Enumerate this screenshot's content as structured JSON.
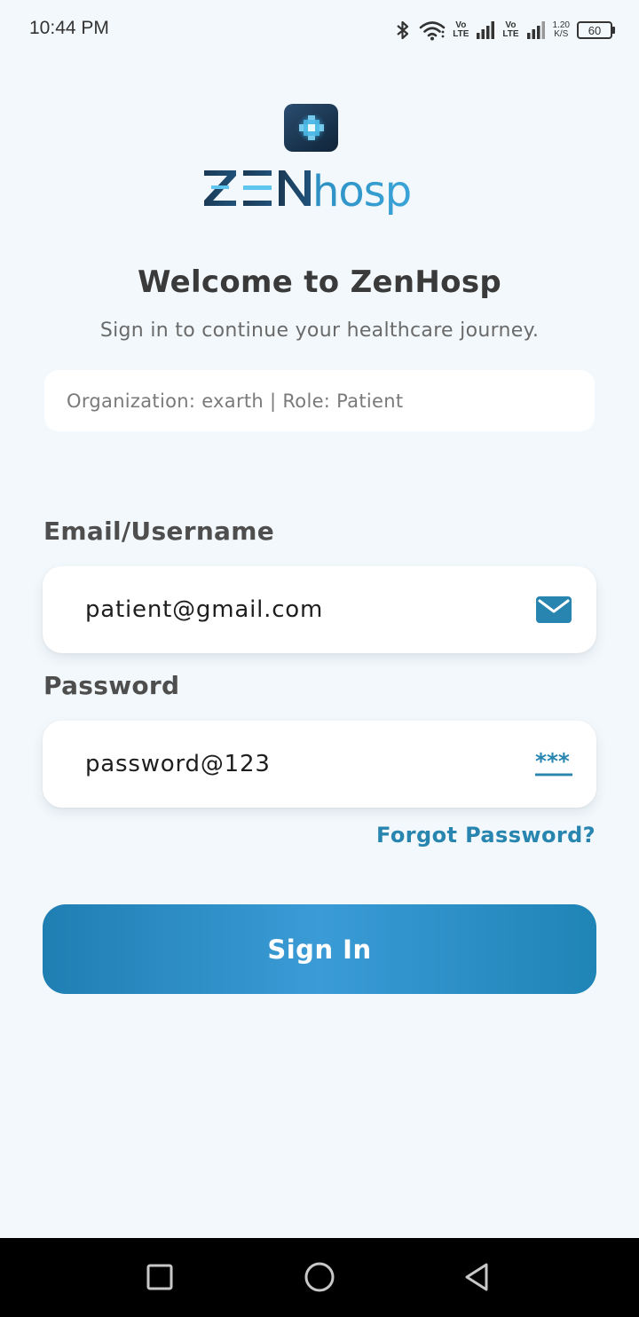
{
  "status_bar": {
    "time": "10:44 PM",
    "volte1_top": "Vo",
    "volte1_bottom": "LTE",
    "volte2_top": "Vo",
    "volte2_bottom": "LTE",
    "speed_value": "1.20",
    "speed_unit": "K/S",
    "battery": "60"
  },
  "logo": {
    "name": "ZENhosp"
  },
  "header": {
    "title": "Welcome to ZenHosp",
    "subtitle": "Sign in to continue your healthcare journey."
  },
  "org_info": "Organization: exarth | Role: Patient",
  "form": {
    "email_label": "Email/Username",
    "email_value": "patient@gmail.com",
    "email_icon": "mail-icon",
    "password_label": "Password",
    "password_value": "password@123",
    "password_icon": "password-icon",
    "forgot_label": "Forgot Password?",
    "signin_label": "Sign In"
  },
  "colors": {
    "background": "#f2f8fb",
    "accent": "#2785b0",
    "button_gradient_mid": "#3a9bd6"
  }
}
